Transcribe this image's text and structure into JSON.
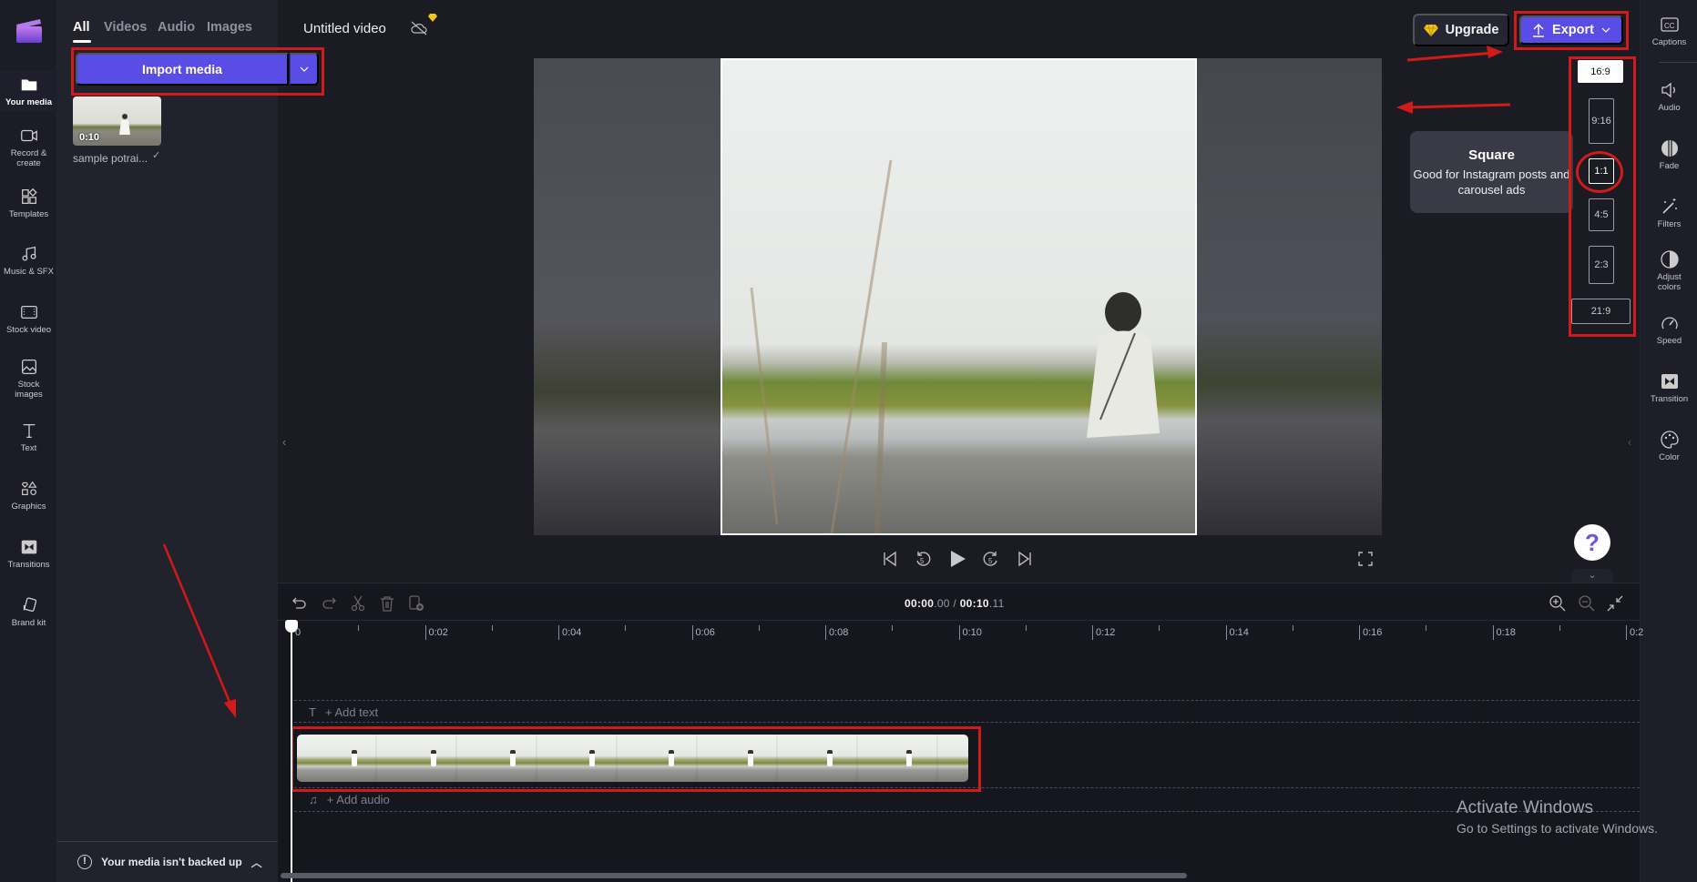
{
  "app": {
    "project_title": "Untitled video",
    "upgrade_label": "Upgrade",
    "export_label": "Export",
    "accent_color": "#5a4de6",
    "annotation_color": "#d11a1a"
  },
  "left_nav": {
    "items": [
      {
        "label": "Your media",
        "icon": "folder-icon",
        "active": true
      },
      {
        "label": "Record &\ncreate",
        "icon": "camera-icon"
      },
      {
        "label": "Templates",
        "icon": "templates-icon"
      },
      {
        "label": "Music & SFX",
        "icon": "music-icon"
      },
      {
        "label": "Stock video",
        "icon": "film-icon"
      },
      {
        "label": "Stock\nimages",
        "icon": "image-icon"
      },
      {
        "label": "Text",
        "icon": "text-icon"
      },
      {
        "label": "Graphics",
        "icon": "shapes-icon"
      },
      {
        "label": "Transitions",
        "icon": "transition-icon"
      },
      {
        "label": "Brand kit",
        "icon": "brand-kit-icon"
      }
    ]
  },
  "media_panel": {
    "tabs": [
      {
        "label": "All",
        "active": true
      },
      {
        "label": "Videos"
      },
      {
        "label": "Audio"
      },
      {
        "label": "Images"
      }
    ],
    "import_label": "Import media",
    "media_items": [
      {
        "name": "sample potrai...",
        "duration": "0:10",
        "status": "check-icon"
      }
    ],
    "backup_warning": "Your media isn't backed up"
  },
  "aspect_ratios": {
    "options": [
      {
        "label": "16:9",
        "selected": true
      },
      {
        "label": "9:16"
      },
      {
        "label": "1:1",
        "hovered": true
      },
      {
        "label": "4:5"
      },
      {
        "label": "2:3"
      },
      {
        "label": "21:9"
      }
    ],
    "tooltip": {
      "title": "Square",
      "description": "Good for Instagram posts and carousel ads"
    }
  },
  "right_nav": {
    "items": [
      {
        "label": "Captions",
        "icon": "captions-icon"
      },
      {
        "label": "Audio",
        "icon": "speaker-icon"
      },
      {
        "label": "Fade",
        "icon": "fade-icon"
      },
      {
        "label": "Filters",
        "icon": "magic-wand-icon"
      },
      {
        "label": "Adjust\ncolors",
        "icon": "contrast-icon"
      },
      {
        "label": "Speed",
        "icon": "speedometer-icon"
      },
      {
        "label": "Transition",
        "icon": "transition-icon"
      },
      {
        "label": "Color",
        "icon": "palette-icon"
      }
    ]
  },
  "player": {
    "controls": [
      "skip-back-icon",
      "rewind-5-icon",
      "play-icon",
      "forward-5-icon",
      "skip-forward-icon"
    ],
    "fullscreen": "fullscreen-icon",
    "help": "?"
  },
  "timeline": {
    "current_time_main": "00:00",
    "current_time_frac": ".00",
    "separator": " / ",
    "total_time_main": "00:10",
    "total_time_frac": ".11",
    "toolbar": [
      "undo-icon",
      "redo-icon",
      "split-icon",
      "delete-icon",
      "add-clip-icon"
    ],
    "zoom_controls": [
      "zoom-in-icon",
      "zoom-out-icon",
      "fit-icon"
    ],
    "ruler_labels": [
      "0",
      "0:02",
      "0:04",
      "0:06",
      "0:08",
      "0:10",
      "0:12",
      "0:14",
      "0:16",
      "0:18",
      "0:2"
    ],
    "add_text_label": "+ Add text",
    "add_audio_label": "+ Add audio"
  },
  "watermark": {
    "title": "Activate Windows",
    "subtitle": "Go to Settings to activate Windows."
  }
}
